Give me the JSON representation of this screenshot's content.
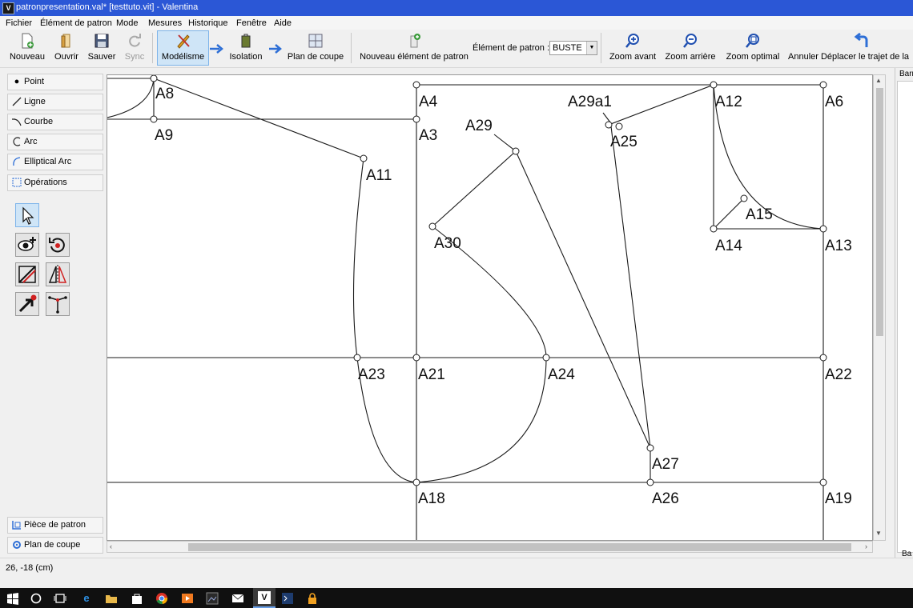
{
  "window": {
    "title": "patronpresentation.val* [testtuto.vit] - Valentina",
    "app_icon_letter": "V"
  },
  "menu": {
    "items": [
      "Fichier",
      "Élément de patron",
      "Mode",
      "Mesures",
      "Historique",
      "Fenêtre",
      "Aide"
    ]
  },
  "toolbar": {
    "nouveau": "Nouveau",
    "ouvrir": "Ouvrir",
    "sauver": "Sauver",
    "sync": "Sync",
    "modelisme": "Modélisme",
    "isolation": "Isolation",
    "plan_de_coupe": "Plan de coupe",
    "nouvel_element": "Nouveau élément de patron",
    "element_label": "Élément de patron :",
    "element_value": "BUSTE",
    "zoom_avant": "Zoom avant",
    "zoom_arriere": "Zoom arrière",
    "zoom_optimal": "Zoom optimal",
    "annuler": "Annuler Déplacer le trajet de la"
  },
  "left_panel": {
    "items": [
      "Point",
      "Ligne",
      "Courbe",
      "Arc",
      "Elliptical Arc",
      "Opérations"
    ],
    "bottom": [
      "Pièce de patron",
      "Plan de coupe"
    ]
  },
  "canvas": {
    "labels": [
      "A8",
      "A9",
      "A11",
      "A4",
      "A3",
      "A29",
      "A29a1",
      "A25",
      "A12",
      "A6",
      "A15",
      "A14",
      "A13",
      "A30",
      "A23",
      "A21",
      "A24",
      "A22",
      "A27",
      "A18",
      "A26",
      "A19"
    ]
  },
  "right_panel": {
    "top_text": "Barr",
    "bottom_text": "Ba"
  },
  "status": {
    "coords": "26, -18 (cm)"
  },
  "colors": {
    "titlebar": "#2b57d6",
    "canvas_bg": "#ffffff",
    "line": "#1a1a1a",
    "taskbar": "#101010",
    "active_button": "#cfe5f7"
  }
}
